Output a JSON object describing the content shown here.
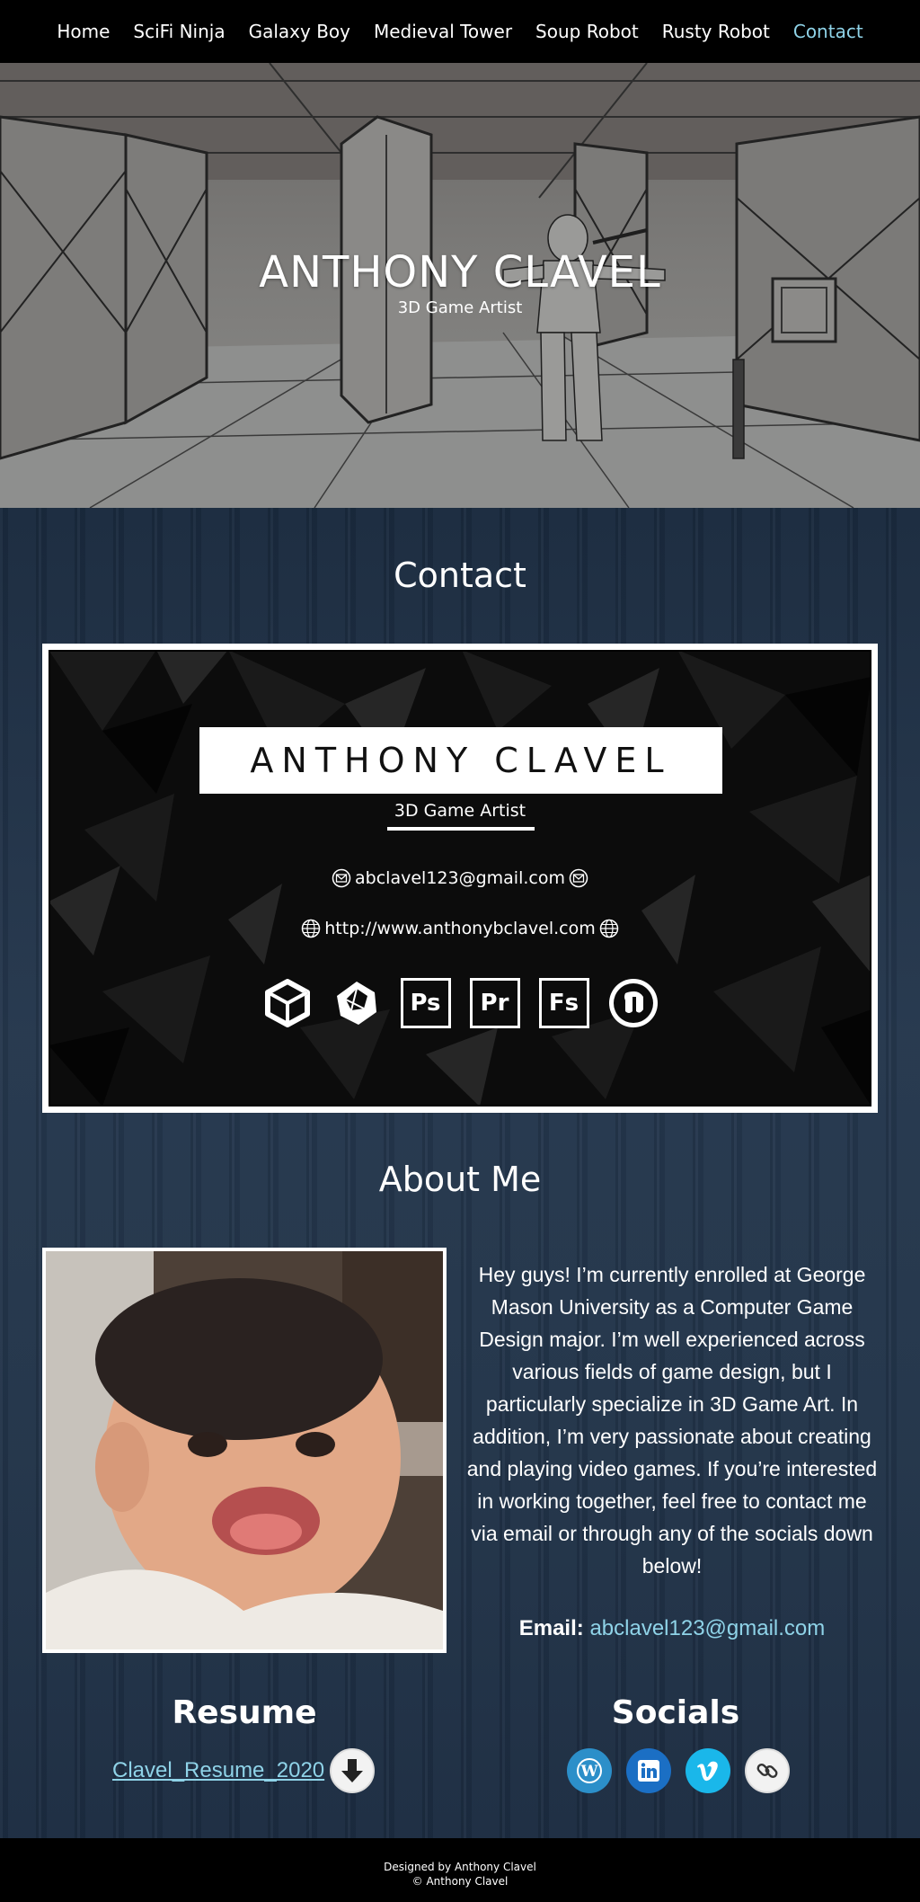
{
  "nav": {
    "items": [
      {
        "label": "Home"
      },
      {
        "label": "SciFi Ninja"
      },
      {
        "label": "Galaxy Boy"
      },
      {
        "label": "Medieval Tower"
      },
      {
        "label": "Soup Robot"
      },
      {
        "label": "Rusty Robot"
      },
      {
        "label": "Contact",
        "active": true
      }
    ],
    "active_color": "#8fd3e8"
  },
  "hero": {
    "title": "ANTHONY CLAVEL",
    "subtitle": "3D Game Artist"
  },
  "contact": {
    "heading": "Contact",
    "card": {
      "name": "ANTHONY CLAVEL",
      "role": "3D Game Artist",
      "email": "abclavel123@gmail.com",
      "website": "http://www.anthonybclavel.com",
      "tools": [
        {
          "icon": "unity-icon"
        },
        {
          "icon": "zbrush-icon"
        },
        {
          "icon": "photoshop-icon",
          "label": "Ps"
        },
        {
          "icon": "premiere-icon",
          "label": "Pr"
        },
        {
          "icon": "fuse-icon",
          "label": "Fs"
        },
        {
          "icon": "unreal-icon"
        }
      ]
    }
  },
  "about": {
    "heading": "About Me",
    "text": "Hey guys! I’m currently enrolled at George Mason University as a Computer Game Design major. I’m well experienced across various fields of game design, but I particularly specialize in 3D Game Art. In addition, I’m very passionate about creating and playing video games. If you’re interested in working together, feel free to contact me via email or through any of the socials down below!",
    "email_label": "Email:",
    "email": "abclavel123@gmail.com"
  },
  "resume": {
    "heading": "Resume",
    "file": "Clavel_Resume_2020"
  },
  "socials": {
    "heading": "Socials",
    "items": [
      {
        "icon": "wordpress-icon",
        "color": "#2c8fc9"
      },
      {
        "icon": "linkedin-icon",
        "color": "#1b6fc4"
      },
      {
        "icon": "vimeo-icon",
        "color": "#1ab7ea"
      },
      {
        "icon": "link-icon",
        "color": "#f2f2f2"
      }
    ]
  },
  "footer": {
    "line1": "Designed by Anthony Clavel",
    "line2": "© Anthony Clavel"
  }
}
